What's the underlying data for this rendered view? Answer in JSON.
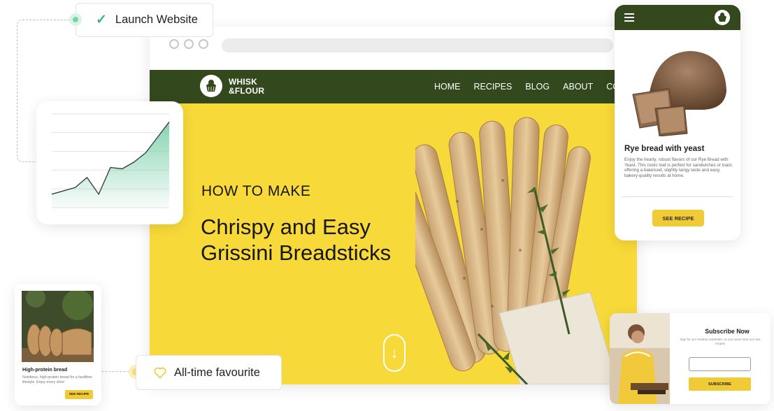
{
  "launch_badge": {
    "label": "Launch Website",
    "icon": "check-icon"
  },
  "favourite_badge": {
    "label": "All-time favourite",
    "icon": "heart-icon"
  },
  "browser": {
    "brand": {
      "line1": "WHISK",
      "line2": "&FLOUR"
    },
    "nav": [
      "HOME",
      "RECIPES",
      "BLOG",
      "ABOUT",
      "CONTA"
    ],
    "hero": {
      "kicker": "HOW TO MAKE",
      "title_line1": "Chrispy and Easy",
      "title_line2": "Grissini Breadsticks",
      "scroll_arrow": "↓"
    }
  },
  "growth_chart": {
    "icon": "area-line-chart"
  },
  "chart_data": {
    "type": "area",
    "title": "",
    "xlabel": "",
    "ylabel": "",
    "x": [
      0,
      1,
      2,
      3,
      4,
      5,
      6,
      7,
      8,
      9,
      10
    ],
    "values": [
      2.0,
      2.5,
      3.0,
      4.5,
      2.0,
      6.0,
      5.8,
      6.8,
      8.2,
      10.5,
      12.8
    ],
    "ylim": [
      0,
      14
    ],
    "grid": true,
    "color": "#7fd1ac"
  },
  "mobile": {
    "title": "Rye bread with yeast",
    "description": "Enjoy the hearty, robust flavors of our Rye Bread with Yeast. This rustic loaf is perfect for sandwiches or toast, offering a balanced, slightly tangy taste and easy, bakery-quality results at home.",
    "button": "SEE RECIPE"
  },
  "small_card": {
    "title": "High-protein bread",
    "description": "Nutritious, high-protein bread for a healthier lifestyle. Enjoy every slice!",
    "button": "SEE RECIPE"
  },
  "subscribe": {
    "title": "Subscribe Now",
    "description": "Sign for our monthly newsletter, so you never miss our new recipes",
    "input_placeholder": "",
    "button": "SUBSCRIBE"
  },
  "colors": {
    "brand_green": "#33481c",
    "hero_yellow": "#f7d939",
    "button_yellow": "#f1cb35",
    "success_green": "#3cb371",
    "node_green": "#9fe3bf",
    "node_yellow": "#f3dc73"
  }
}
